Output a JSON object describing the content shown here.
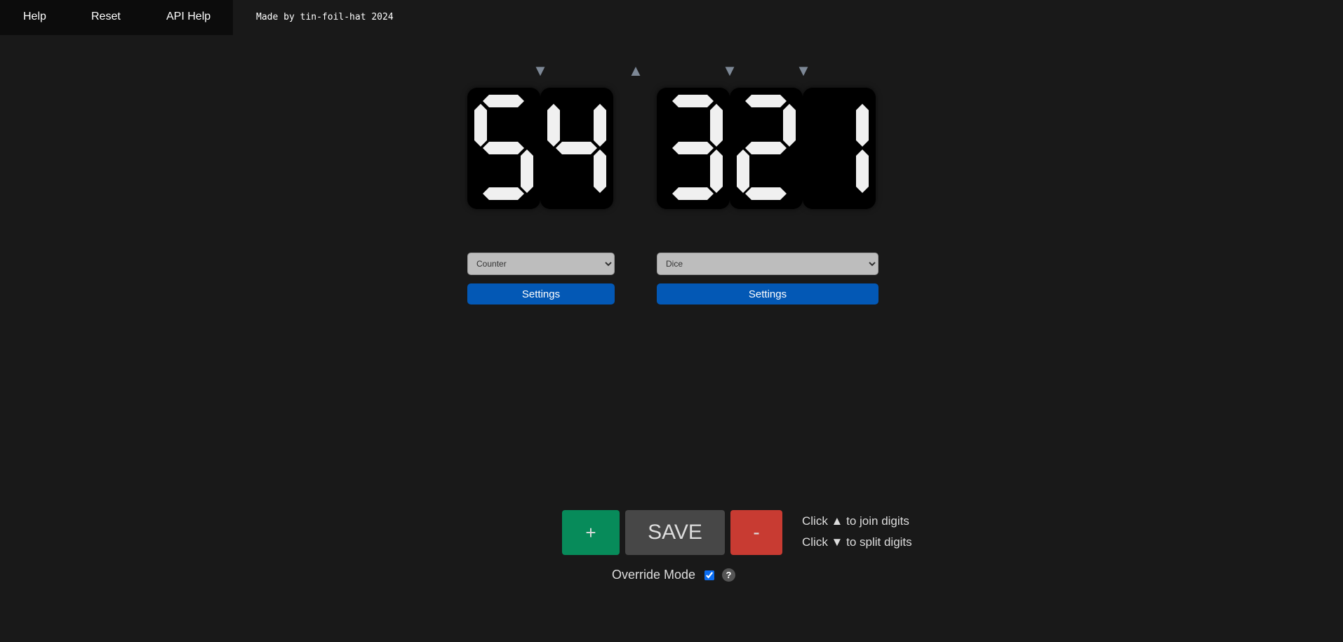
{
  "nav": {
    "items": [
      {
        "label": "Help"
      },
      {
        "label": "Reset"
      },
      {
        "label": "API Help"
      }
    ]
  },
  "credit": "Made by tin-foil-hat 2024",
  "arrows": [
    {
      "symbol": "▼",
      "action": "split"
    },
    {
      "symbol": "▲",
      "action": "join"
    },
    {
      "symbol": "▼",
      "action": "split"
    },
    {
      "symbol": "▼",
      "action": "split"
    }
  ],
  "groups": [
    {
      "digits": "54",
      "mode": "Counter",
      "settings_label": "Settings"
    },
    {
      "digits": "321",
      "mode": "Dice",
      "settings_label": "Settings"
    }
  ],
  "controls": {
    "plus_label": "+",
    "save_label": "SAVE",
    "minus_label": "-"
  },
  "hints": [
    "Click ▲ to join digits",
    "Click ▼ to split digits"
  ],
  "override": {
    "label": "Override Mode",
    "checked": true,
    "help_label": "?"
  },
  "colors": {
    "plus": "#078b5a",
    "save": "#474747",
    "minus": "#c83b32",
    "settings": "#0358b5",
    "segment": "#f0f0f0",
    "arrow": "#7d8896"
  }
}
